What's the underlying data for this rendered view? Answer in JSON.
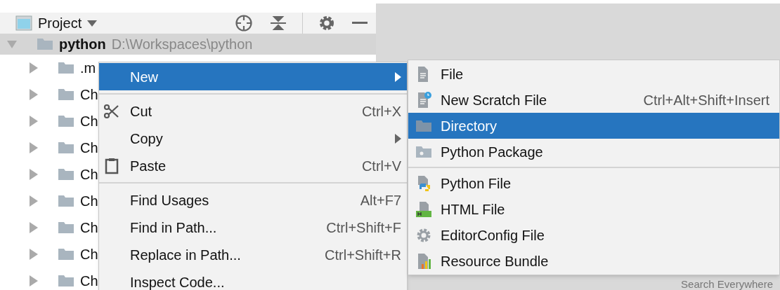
{
  "project_panel": {
    "title": "Project"
  },
  "tree": {
    "root": {
      "name": "python",
      "path": "D:\\Workspaces\\python",
      "expanded": true,
      "selected": true
    },
    "children": [
      {
        "name": ".m"
      },
      {
        "name": "Ch"
      },
      {
        "name": "Ch"
      },
      {
        "name": "Ch"
      },
      {
        "name": "Ch"
      },
      {
        "name": "Ch"
      },
      {
        "name": "Ch"
      },
      {
        "name": "Ch"
      },
      {
        "name": "Ch"
      }
    ]
  },
  "context_menu": {
    "groups": [
      [
        {
          "label": "New",
          "kind": "plain",
          "submenu": true,
          "selected": true
        }
      ],
      [
        {
          "label": "Cut",
          "kind": "scissors",
          "shortcut": "Ctrl+X",
          "submenu": false,
          "selected": false
        },
        {
          "label": "Copy",
          "kind": "plain",
          "submenu": true,
          "selected": false
        },
        {
          "label": "Paste",
          "kind": "clipboard",
          "shortcut": "Ctrl+V",
          "submenu": false,
          "selected": false
        }
      ],
      [
        {
          "label": "Find Usages",
          "kind": "plain",
          "shortcut": "Alt+F7",
          "submenu": false,
          "selected": false
        },
        {
          "label": "Find in Path...",
          "kind": "plain",
          "shortcut": "Ctrl+Shift+F",
          "submenu": false,
          "selected": false
        },
        {
          "label": "Replace in Path...",
          "kind": "plain",
          "shortcut": "Ctrl+Shift+R",
          "submenu": false,
          "selected": false
        },
        {
          "label": "Inspect Code...",
          "kind": "plain",
          "submenu": false,
          "selected": false
        }
      ]
    ]
  },
  "new_submenu": {
    "groups": [
      [
        {
          "label": "File",
          "kind": "file",
          "selected": false
        },
        {
          "label": "New Scratch File",
          "kind": "scratch",
          "shortcut": "Ctrl+Alt+Shift+Insert",
          "selected": false
        },
        {
          "label": "Directory",
          "kind": "folder",
          "selected": true
        },
        {
          "label": "Python Package",
          "kind": "package",
          "selected": false
        }
      ],
      [
        {
          "label": "Python File",
          "kind": "python",
          "selected": false
        },
        {
          "label": "HTML File",
          "kind": "html",
          "selected": false
        },
        {
          "label": "EditorConfig File",
          "kind": "editorconfig",
          "selected": false
        },
        {
          "label": "Resource Bundle",
          "kind": "bundle",
          "selected": false
        }
      ]
    ]
  },
  "editor_hint": "Search Everywhere"
}
